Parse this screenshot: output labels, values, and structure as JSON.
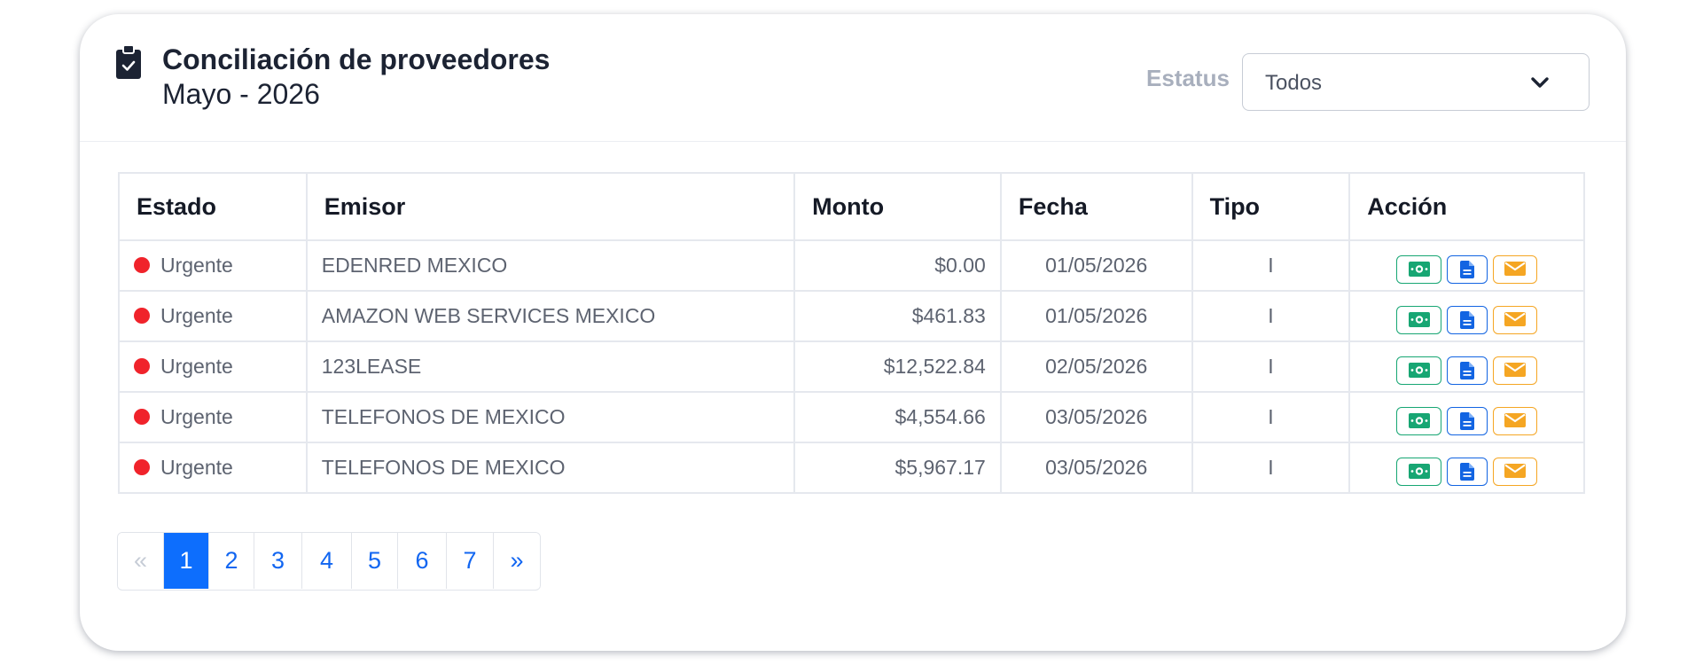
{
  "header": {
    "title": "Conciliación de proveedores",
    "subtitle": "Mayo - 2026",
    "title_icon": "clipboard-check-icon"
  },
  "filter": {
    "label": "Estatus",
    "selected": "Todos",
    "chevron_icon": "chevron-down-icon"
  },
  "table": {
    "headers": {
      "estado": "Estado",
      "emisor": "Emisor",
      "monto": "Monto",
      "fecha": "Fecha",
      "tipo": "Tipo",
      "accion": "Acción"
    },
    "rows": [
      {
        "estado": "Urgente",
        "emisor": "EDENRED MEXICO",
        "monto": "$0.00",
        "fecha": "01/05/2026",
        "tipo": "I"
      },
      {
        "estado": "Urgente",
        "emisor": "AMAZON WEB SERVICES MEXICO",
        "monto": "$461.83",
        "fecha": "01/05/2026",
        "tipo": "I"
      },
      {
        "estado": "Urgente",
        "emisor": "123LEASE",
        "monto": "$12,522.84",
        "fecha": "02/05/2026",
        "tipo": "I"
      },
      {
        "estado": "Urgente",
        "emisor": "TELEFONOS DE MEXICO",
        "monto": "$4,554.66",
        "fecha": "03/05/2026",
        "tipo": "I"
      },
      {
        "estado": "Urgente",
        "emisor": "TELEFONOS DE MEXICO",
        "monto": "$5,967.17",
        "fecha": "03/05/2026",
        "tipo": "I"
      }
    ],
    "action_icons": [
      "money-bill-icon",
      "file-document-icon",
      "envelope-icon"
    ]
  },
  "pagination": {
    "first": "«",
    "pages": [
      "1",
      "2",
      "3",
      "4",
      "5",
      "6",
      "7"
    ],
    "active": "1",
    "last": "»"
  },
  "colors": {
    "urgent": "#f0232b",
    "primary": "#0d6efd",
    "money": "#17a673",
    "doc": "#1264e2",
    "mail": "#f5a623"
  }
}
